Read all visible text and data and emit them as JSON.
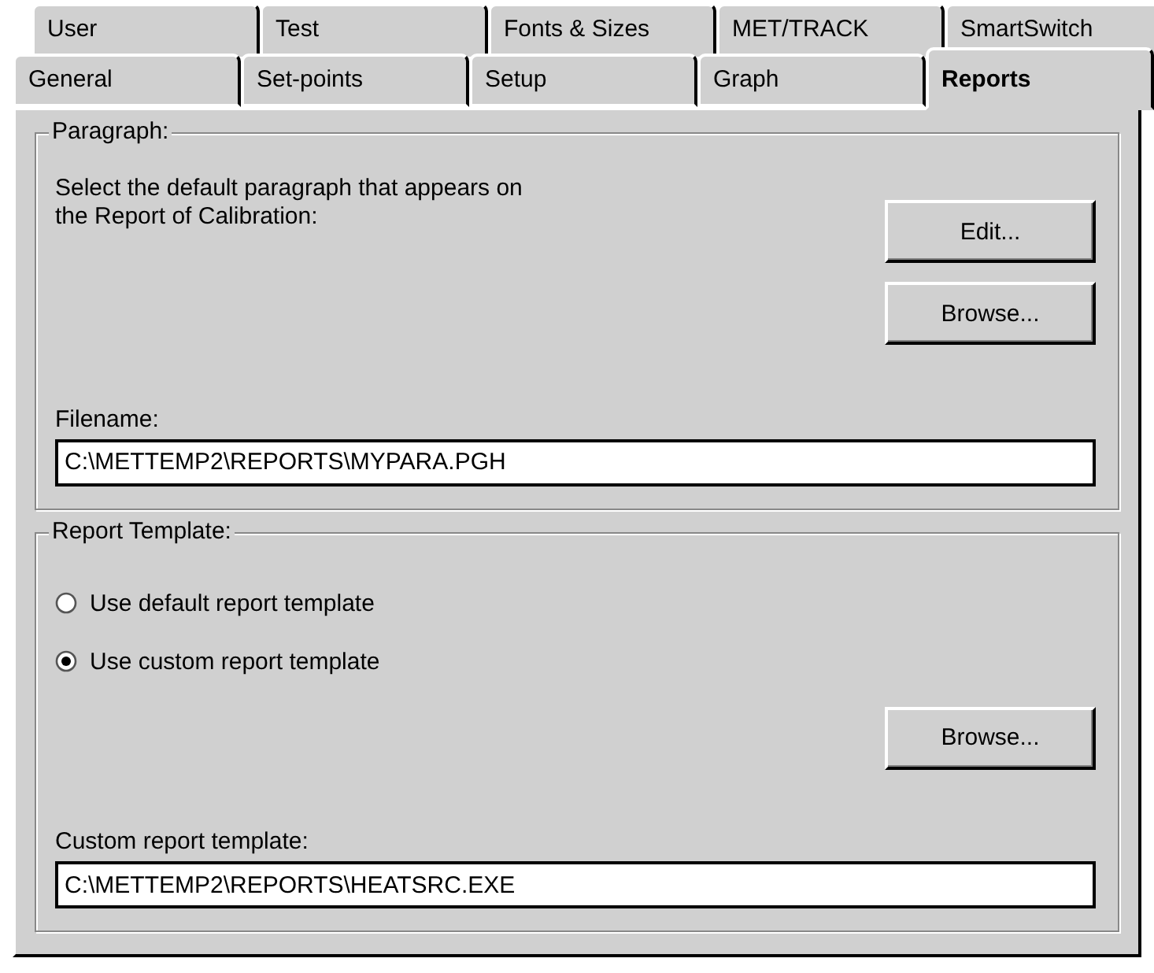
{
  "tabs_back_row": [
    {
      "label": "User",
      "selected": false
    },
    {
      "label": "Test",
      "selected": false
    },
    {
      "label": "Fonts & Sizes",
      "selected": false
    },
    {
      "label": "MET/TRACK",
      "selected": false
    },
    {
      "label": "SmartSwitch",
      "selected": false
    }
  ],
  "tabs_front_row": [
    {
      "label": "General",
      "selected": false
    },
    {
      "label": "Set-points",
      "selected": false
    },
    {
      "label": "Setup",
      "selected": false
    },
    {
      "label": "Graph",
      "selected": false
    },
    {
      "label": "Reports",
      "selected": true
    }
  ],
  "paragraph_group": {
    "title": "Paragraph:",
    "description": "Select the default paragraph that appears on\nthe Report of Calibration:",
    "buttons": [
      {
        "label": "Edit..."
      },
      {
        "label": "Browse..."
      }
    ],
    "filename_label": "Filename:",
    "filename_value": "C:\\METTEMP2\\REPORTS\\MYPARA.PGH"
  },
  "template_group": {
    "title": "Report Template:",
    "options": [
      {
        "label": "Use default report template",
        "selected": false
      },
      {
        "label": "Use custom report template",
        "selected": true
      }
    ],
    "browse_button": {
      "label": "Browse..."
    },
    "field_label": "Custom report template:",
    "field_value": "C:\\METTEMP2\\REPORTS\\HEATSRC.EXE"
  }
}
